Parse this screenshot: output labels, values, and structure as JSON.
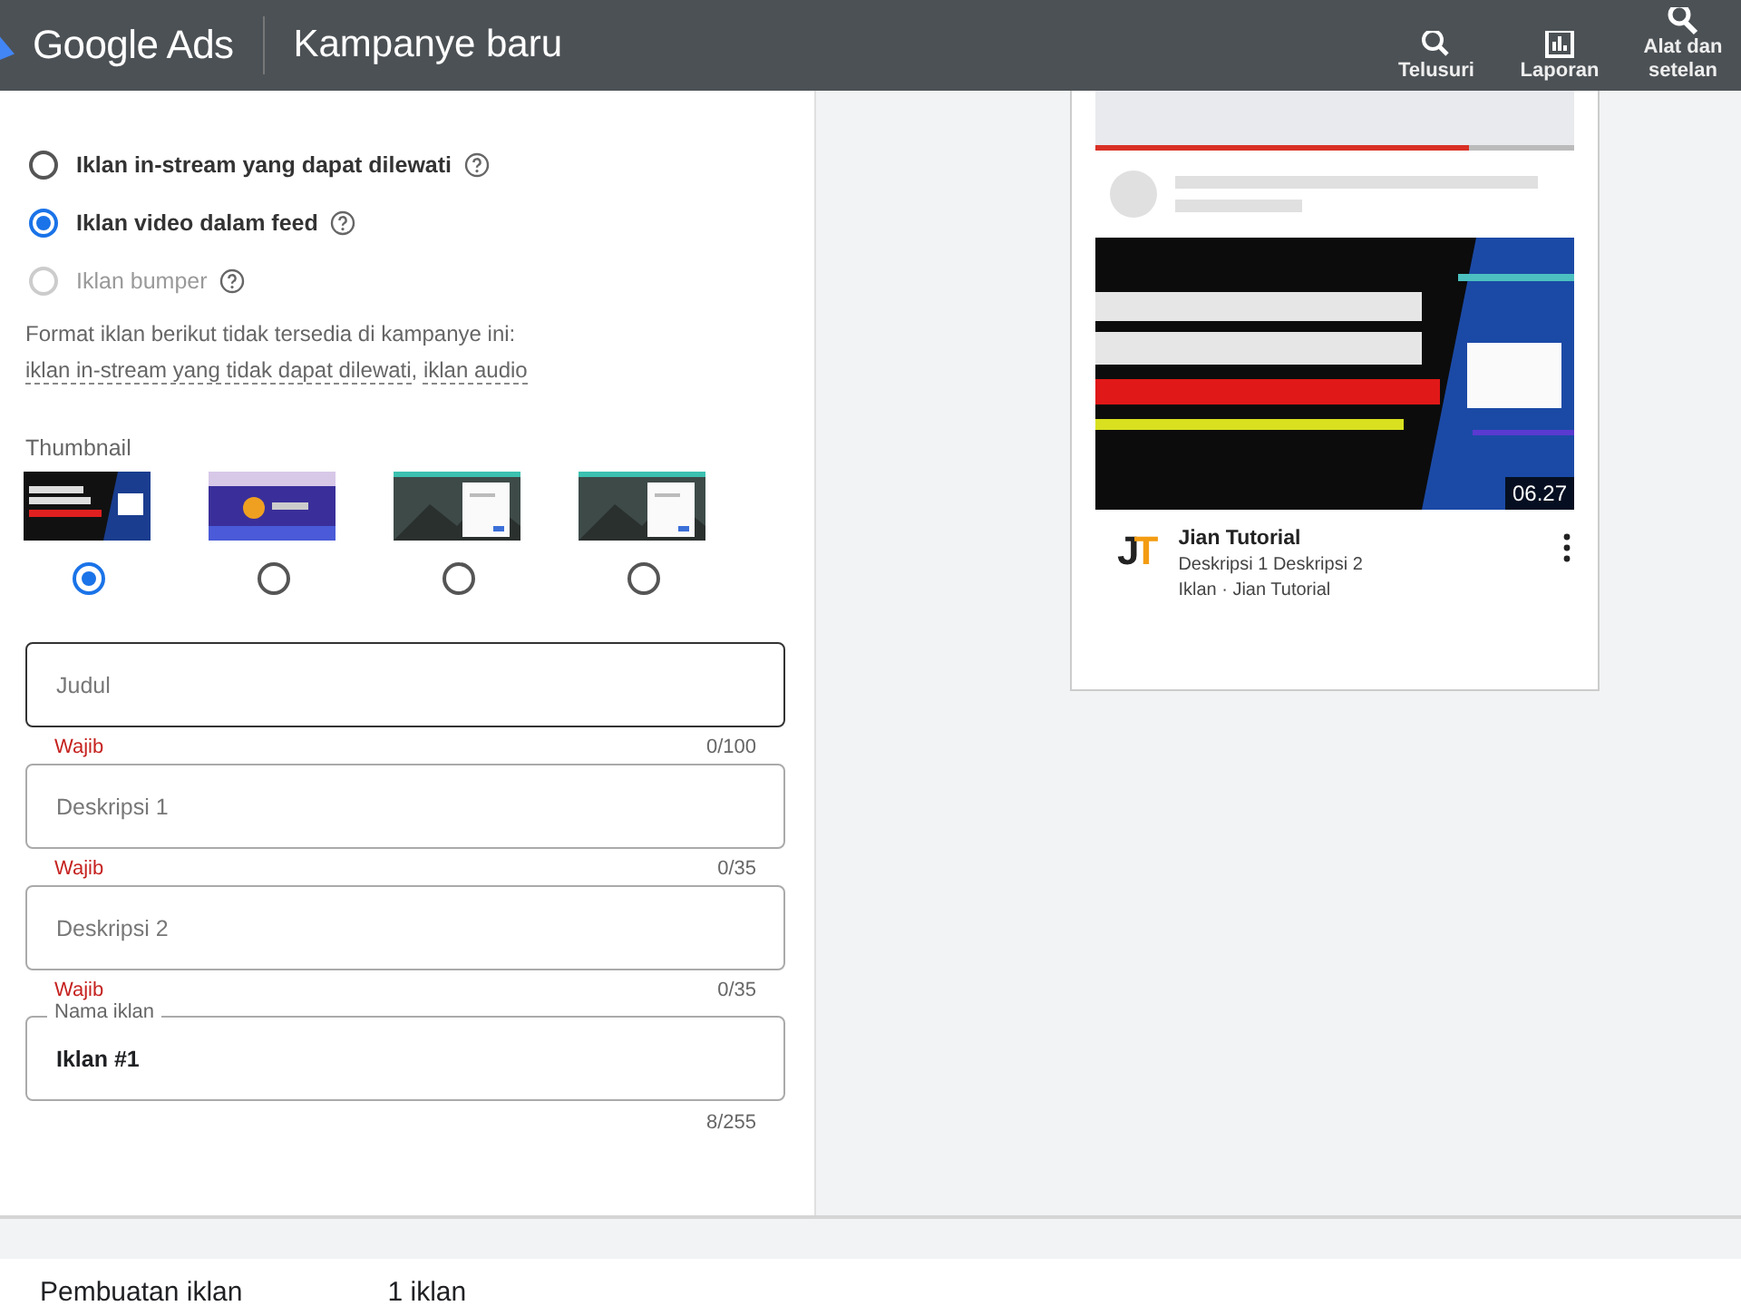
{
  "header": {
    "product": "Google Ads",
    "title": "Kampanye baru",
    "actions": [
      {
        "label": "Telusuri",
        "kind": "search"
      },
      {
        "label": "Laporan",
        "kind": "chart"
      },
      {
        "label": "Alat dan setelan",
        "kind": "tools"
      }
    ]
  },
  "formats": [
    {
      "label": "Iklan in-stream yang dapat dilewati",
      "selected": false,
      "disabled": false
    },
    {
      "label": "Iklan video dalam feed",
      "selected": true,
      "disabled": false
    },
    {
      "label": "Iklan bumper",
      "selected": false,
      "disabled": true
    }
  ],
  "notice": {
    "text": "Format iklan berikut tidak tersedia di kampanye ini: ",
    "links": [
      "iklan in-stream yang tidak dapat dilewati",
      ", ",
      "iklan audio"
    ]
  },
  "thumbnail": {
    "label": "Thumbnail",
    "options": [
      {
        "selected": true
      },
      {
        "selected": false
      },
      {
        "selected": false
      },
      {
        "selected": false
      }
    ]
  },
  "fields": [
    {
      "placeholder": "Judul",
      "helper": "Wajib",
      "counter": "0/100",
      "focused": true
    },
    {
      "placeholder": "Deskripsi 1",
      "helper": "Wajib",
      "counter": "0/35",
      "focused": false
    },
    {
      "placeholder": "Deskripsi 2",
      "helper": "Wajib",
      "counter": "0/35",
      "focused": false
    },
    {
      "label": "Nama iklan",
      "value": "Iklan #1",
      "counter": "8/255",
      "focused": false
    }
  ],
  "preview": {
    "progress": {
      "level": 0.78
    },
    "duration": "06.27",
    "logo": "JT",
    "channel": "Jian Tutorial",
    "description": "Deskripsi 1 Deskripsi 2",
    "meta": "Iklan · Jian Tutorial"
  },
  "summary": {
    "label": "Pembuatan iklan",
    "value": "1 iklan"
  }
}
